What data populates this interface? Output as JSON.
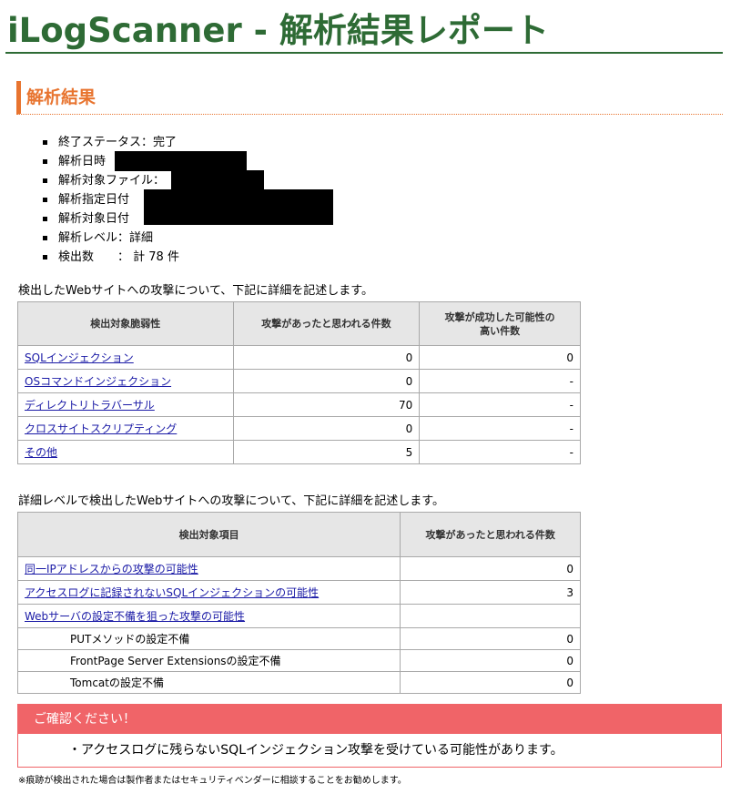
{
  "header": {
    "title": "iLogScanner - 解析結果レポート"
  },
  "section": {
    "title": "解析結果"
  },
  "summary": {
    "status": "終了ステータス：完了",
    "analysis_datetime_label": "解析日時",
    "target_file_label": "解析対象ファイル：",
    "specified_date_label": "解析指定日付",
    "target_date_label": "解析対象日付",
    "level": "解析レベル：詳細",
    "detected": "検出数　　：  計 78 件"
  },
  "table1": {
    "intro": "検出したWebサイトへの攻撃について、下記に詳細を記述します。",
    "headers": [
      "検出対象脆弱性",
      "攻撃があったと思われる件数",
      "攻撃が成功した可能性の",
      "高い件数"
    ],
    "rows": [
      {
        "name": "SQLインジェクション",
        "attacks": "0",
        "success": "0"
      },
      {
        "name": "OSコマンドインジェクション",
        "attacks": "0",
        "success": "-"
      },
      {
        "name": "ディレクトリトラバーサル",
        "attacks": "70",
        "success": "-"
      },
      {
        "name": "クロスサイトスクリプティング",
        "attacks": "0",
        "success": "-"
      },
      {
        "name": "その他",
        "attacks": "5",
        "success": "-"
      }
    ]
  },
  "table2": {
    "intro": "詳細レベルで検出したWebサイトへの攻撃について、下記に詳細を記述します。",
    "headers": [
      "検出対象項目",
      "攻撃があったと思われる件数"
    ],
    "rows": [
      {
        "name": "同一IPアドレスからの攻撃の可能性",
        "count": "0"
      },
      {
        "name": "アクセスログに記録されないSQLインジェクションの可能性",
        "count": "3"
      },
      {
        "name": "Webサーバの設定不備を狙った攻撃の可能性",
        "count": ""
      }
    ],
    "subrows": [
      {
        "name": "PUTメソッドの設定不備",
        "count": "0"
      },
      {
        "name": "FrontPage Server Extensionsの設定不備",
        "count": "0"
      },
      {
        "name": "Tomcatの設定不備",
        "count": "0"
      }
    ]
  },
  "notice": {
    "title": "ご確認ください！",
    "message": "・アクセスログに残らないSQLインジェクション攻撃を受けている可能性があります。"
  },
  "footnote": "※痕跡が検出された場合は製作者またはセキュリティベンダーに相談することをお勧めします。"
}
